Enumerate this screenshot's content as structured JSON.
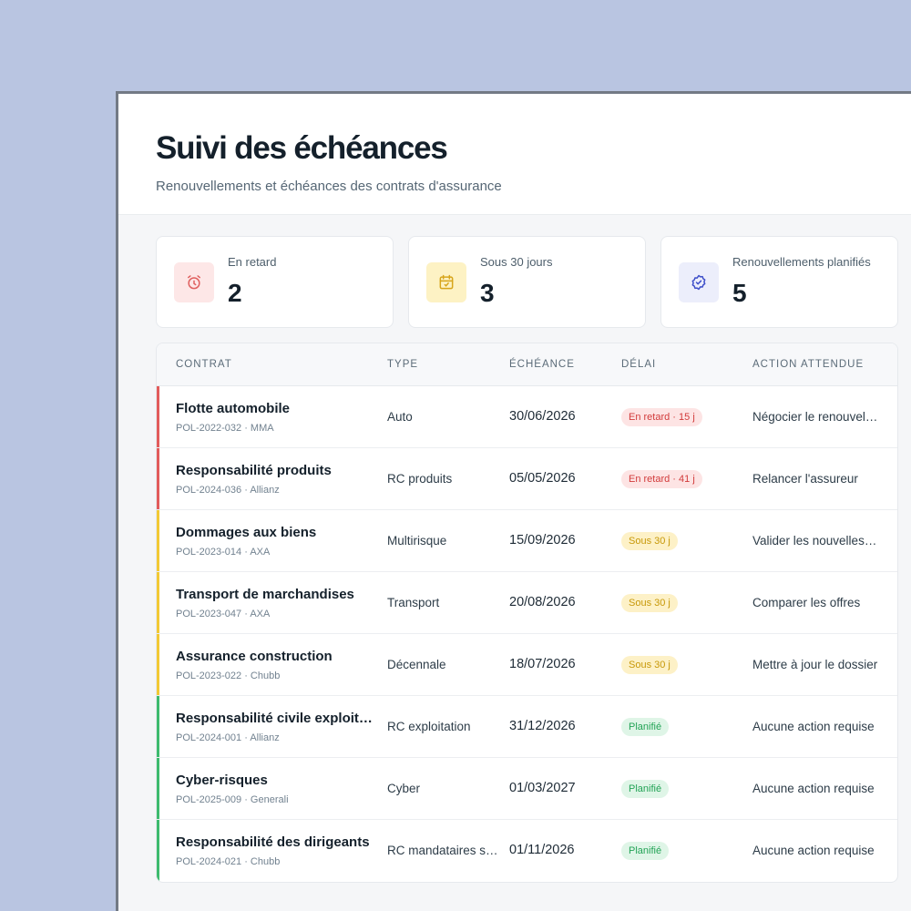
{
  "header": {
    "title": "Suivi des échéances",
    "subtitle": "Renouvellements et échéances des contrats d'assurance"
  },
  "stats": [
    {
      "label": "En retard",
      "value": "2",
      "icon": "alarm-clock-icon",
      "bg": "#fde7e7",
      "fg": "#e0605f"
    },
    {
      "label": "Sous 30 jours",
      "value": "3",
      "icon": "calendar-icon",
      "bg": "#fdf2c4",
      "fg": "#d7a51b"
    },
    {
      "label": "Renouvellements planifiés",
      "value": "5",
      "icon": "badge-check-icon",
      "bg": "#eceefb",
      "fg": "#3e4fc9"
    }
  ],
  "table": {
    "columns": [
      "CONTRAT",
      "TYPE",
      "ÉCHÉANCE",
      "DÉLAI",
      "ACTION ATTENDUE"
    ],
    "rows": [
      {
        "name": "Flotte automobile",
        "meta": "POL-2022-032 · MMA",
        "type": "Auto",
        "date": "30/06/2026",
        "badge": "En retard · 15 j",
        "status": "late",
        "action": "Négocier le renouvellement"
      },
      {
        "name": "Responsabilité produits",
        "meta": "POL-2024-036 · Allianz",
        "type": "RC produits",
        "date": "05/05/2026",
        "badge": "En retard · 41 j",
        "status": "late",
        "action": "Relancer l'assureur"
      },
      {
        "name": "Dommages aux biens",
        "meta": "POL-2023-014 · AXA",
        "type": "Multirisque",
        "date": "15/09/2026",
        "badge": "Sous 30 j",
        "status": "soon",
        "action": "Valider les nouvelles conditions"
      },
      {
        "name": "Transport de marchandises",
        "meta": "POL-2023-047 · AXA",
        "type": "Transport",
        "date": "20/08/2026",
        "badge": "Sous 30 j",
        "status": "soon",
        "action": "Comparer les offres"
      },
      {
        "name": "Assurance construction",
        "meta": "POL-2023-022 · Chubb",
        "type": "Décennale",
        "date": "18/07/2026",
        "badge": "Sous 30 j",
        "status": "soon",
        "action": "Mettre à jour le dossier"
      },
      {
        "name": "Responsabilité civile exploitation",
        "meta": "POL-2024-001 · Allianz",
        "type": "RC exploitation",
        "date": "31/12/2026",
        "badge": "Planifié",
        "status": "ok",
        "action": "Aucune action requise"
      },
      {
        "name": "Cyber-risques",
        "meta": "POL-2025-009 · Generali",
        "type": "Cyber",
        "date": "01/03/2027",
        "badge": "Planifié",
        "status": "ok",
        "action": "Aucune action requise"
      },
      {
        "name": "Responsabilité des dirigeants",
        "meta": "POL-2024-021 · Chubb",
        "type": "RC mandataires sociaux",
        "date": "01/11/2026",
        "badge": "Planifié",
        "status": "ok",
        "action": "Aucune action requise"
      }
    ]
  },
  "colors": {
    "late": "#e25b5b",
    "soon": "#f2c934",
    "ok": "#3dbb6e"
  }
}
